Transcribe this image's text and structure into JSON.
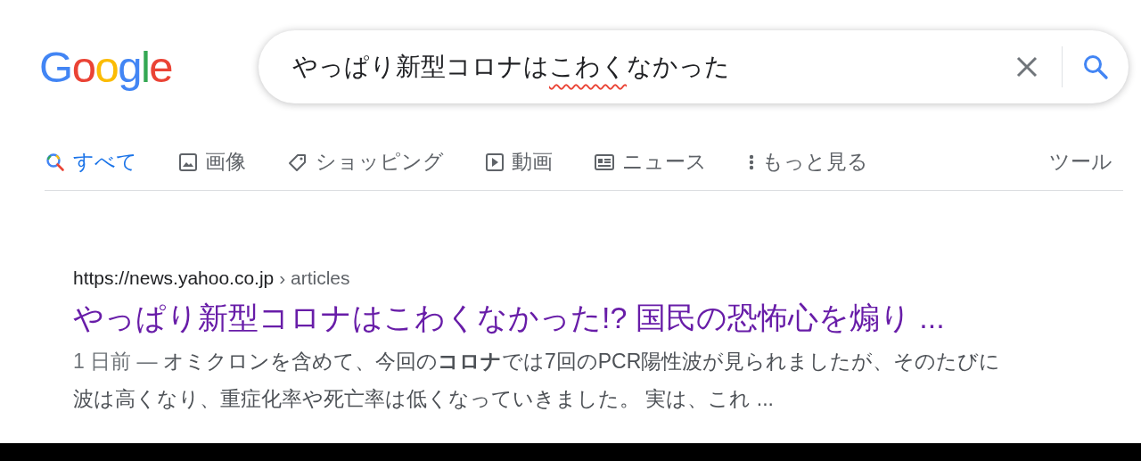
{
  "logo": "Google",
  "search": {
    "query": [
      {
        "text": "やっぱり新型コロナは",
        "misspelled": false
      },
      {
        "text": "こわく",
        "misspelled": true
      },
      {
        "text": "なかった",
        "misspelled": false
      }
    ]
  },
  "tabs": [
    {
      "label": "すべて",
      "kind": "search",
      "selected": true
    },
    {
      "label": "画像",
      "kind": "image",
      "selected": false
    },
    {
      "label": "ショッピング",
      "kind": "tag",
      "selected": false
    },
    {
      "label": "動画",
      "kind": "play",
      "selected": false
    },
    {
      "label": "ニュース",
      "kind": "news",
      "selected": false
    },
    {
      "label": "もっと見る",
      "kind": "more",
      "selected": false
    }
  ],
  "tools": "ツール",
  "result": {
    "url": "https://news.yahoo.co.jp",
    "breadcrumb": "› articles",
    "title": "やっぱり新型コロナはこわくなかった!? 国民の恐怖心を煽り ...",
    "visited": true,
    "date": "1 日前 —",
    "snippet": "オミクロンを含めて、今回の**コロナ**では7回のPCR陽性波が見られましたが、そのたびに波は高くなり、重症化率や死亡率は低くなっていきました。 実は、これ ..."
  }
}
